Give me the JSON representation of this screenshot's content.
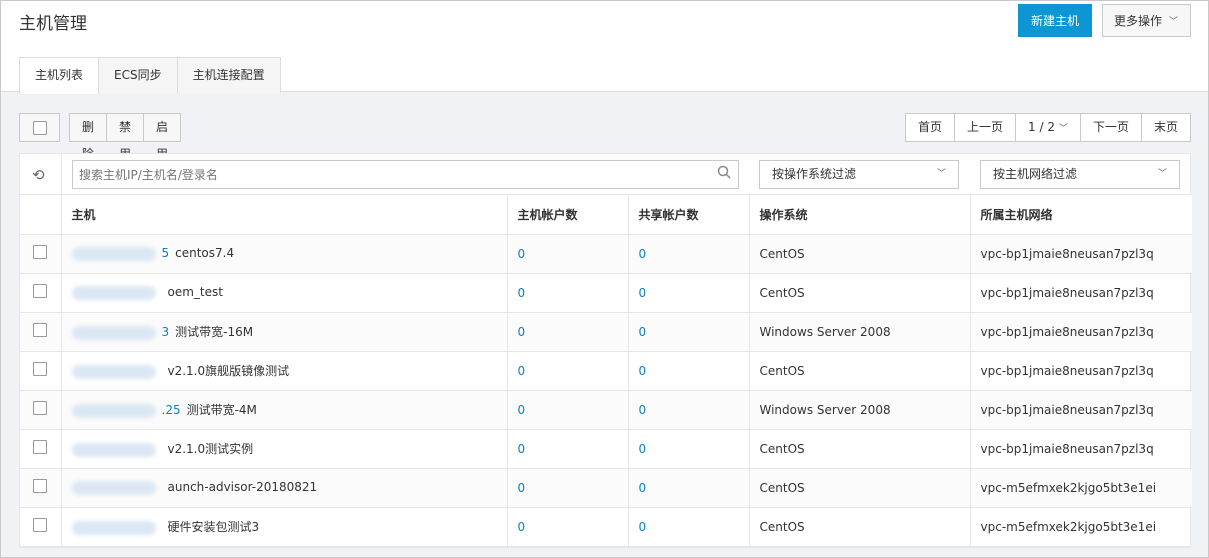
{
  "header": {
    "title": "主机管理",
    "new_button": "新建主机",
    "more_button": "更多操作"
  },
  "tabs": [
    {
      "label": "主机列表"
    },
    {
      "label": "ECS同步"
    },
    {
      "label": "主机连接配置"
    }
  ],
  "toolbar": {
    "delete": "删除",
    "disable": "禁用",
    "enable": "启用"
  },
  "pager": {
    "first": "首页",
    "prev": "上一页",
    "current": "1 / 2",
    "next": "下一页",
    "last": "末页"
  },
  "filters": {
    "search_placeholder": "搜索主机IP/主机名/登录名",
    "os_filter": "按操作系统过滤",
    "network_filter": "按主机网络过滤"
  },
  "columns": {
    "host": "主机",
    "host_accounts": "主机帐户数",
    "shared_accounts": "共享帐户数",
    "os": "操作系统",
    "network": "所属主机网络"
  },
  "rows": [
    {
      "ip_suffix": "5",
      "name": "centos7.4",
      "host_accounts": "0",
      "shared_accounts": "0",
      "os": "CentOS",
      "network": "vpc-bp1jmaie8neusan7pzl3q"
    },
    {
      "ip_suffix": "",
      "name": "oem_test",
      "host_accounts": "0",
      "shared_accounts": "0",
      "os": "CentOS",
      "network": "vpc-bp1jmaie8neusan7pzl3q"
    },
    {
      "ip_suffix": "3",
      "name": "测试带宽-16M",
      "host_accounts": "0",
      "shared_accounts": "0",
      "os": "Windows Server 2008",
      "network": "vpc-bp1jmaie8neusan7pzl3q"
    },
    {
      "ip_suffix": "",
      "name": "v2.1.0旗舰版镜像测试",
      "host_accounts": "0",
      "shared_accounts": "0",
      "os": "CentOS",
      "network": "vpc-bp1jmaie8neusan7pzl3q"
    },
    {
      "ip_suffix": ".25",
      "name": "测试带宽-4M",
      "host_accounts": "0",
      "shared_accounts": "0",
      "os": "Windows Server 2008",
      "network": "vpc-bp1jmaie8neusan7pzl3q"
    },
    {
      "ip_suffix": "",
      "name": "v2.1.0测试实例",
      "host_accounts": "0",
      "shared_accounts": "0",
      "os": "CentOS",
      "network": "vpc-bp1jmaie8neusan7pzl3q"
    },
    {
      "ip_suffix": "",
      "name": "aunch-advisor-20180821",
      "host_accounts": "0",
      "shared_accounts": "0",
      "os": "CentOS",
      "network": "vpc-m5efmxek2kjgo5bt3e1ei"
    },
    {
      "ip_suffix": "",
      "name": "硬件安装包测试3",
      "host_accounts": "0",
      "shared_accounts": "0",
      "os": "CentOS",
      "network": "vpc-m5efmxek2kjgo5bt3e1ei"
    }
  ]
}
